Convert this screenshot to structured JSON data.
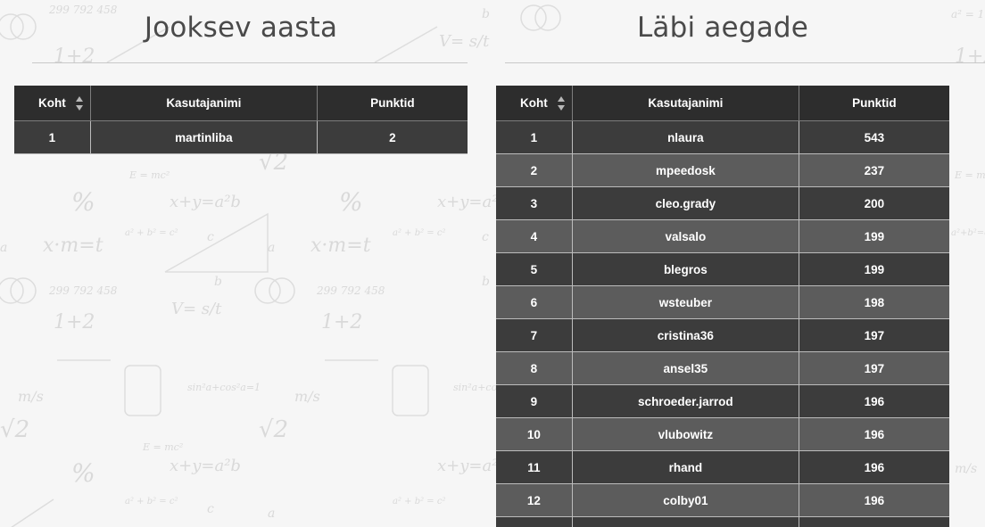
{
  "left_panel": {
    "title": "Jooksev aasta",
    "headers": {
      "rank": "Koht",
      "username": "Kasutajanimi",
      "points": "Punktid"
    },
    "rows": [
      {
        "rank": "1",
        "username": "martinliba",
        "points": "2"
      }
    ]
  },
  "right_panel": {
    "title": "Läbi aegade",
    "headers": {
      "rank": "Koht",
      "username": "Kasutajanimi",
      "points": "Punktid"
    },
    "rows": [
      {
        "rank": "1",
        "username": "nlaura",
        "points": "543"
      },
      {
        "rank": "2",
        "username": "mpeedosk",
        "points": "237"
      },
      {
        "rank": "3",
        "username": "cleo.grady",
        "points": "200"
      },
      {
        "rank": "4",
        "username": "valsalo",
        "points": "199"
      },
      {
        "rank": "5",
        "username": "blegros",
        "points": "199"
      },
      {
        "rank": "6",
        "username": "wsteuber",
        "points": "198"
      },
      {
        "rank": "7",
        "username": "cristina36",
        "points": "197"
      },
      {
        "rank": "8",
        "username": "ansel35",
        "points": "197"
      },
      {
        "rank": "9",
        "username": "schroeder.jarrod",
        "points": "196"
      },
      {
        "rank": "10",
        "username": "vlubowitz",
        "points": "196"
      },
      {
        "rank": "11",
        "username": "rhand",
        "points": "196"
      },
      {
        "rank": "12",
        "username": "colby01",
        "points": "196"
      }
    ]
  },
  "icons": {
    "sort": "sort-icon"
  },
  "colors": {
    "header_bg": "#2d2d2d",
    "row_dark": "#3c3c3c",
    "row_light": "#5c5c5c",
    "title_text": "#4a4a4a",
    "background": "#f6f6f6"
  }
}
